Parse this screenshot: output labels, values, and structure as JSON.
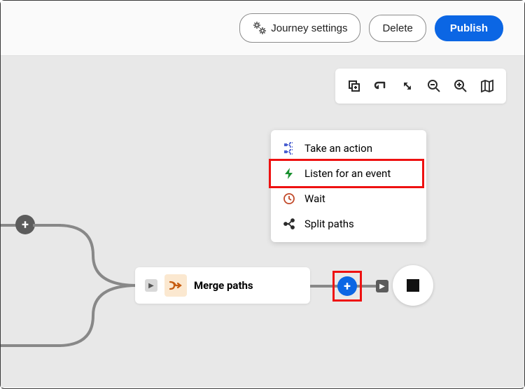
{
  "toolbar": {
    "settings_label": "Journey settings",
    "delete_label": "Delete",
    "publish_label": "Publish"
  },
  "menu": {
    "action_label": "Take an action",
    "listen_label": "Listen for an event",
    "wait_label": "Wait",
    "split_label": "Split paths"
  },
  "node": {
    "merge_label": "Merge paths"
  }
}
